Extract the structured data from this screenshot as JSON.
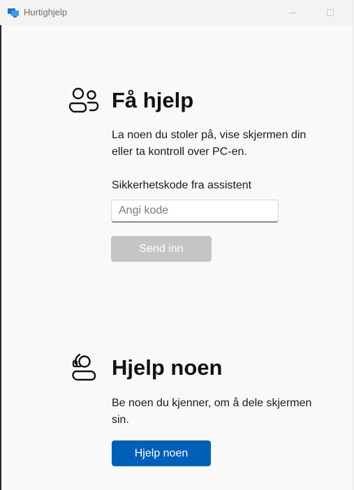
{
  "window": {
    "title": "Hurtighjelp",
    "icon": "remote-desktop-icon"
  },
  "get_help": {
    "icon": "people-icon",
    "heading": "Få hjelp",
    "description_line1": "La noen du stoler på, vise skjermen din",
    "description_line2": "eller ta kontroll over PC-en.",
    "code_label": "Sikkerhetskode fra assistent",
    "code_placeholder": "Angi kode",
    "code_value": "",
    "submit_label": "Send inn",
    "submit_enabled": false
  },
  "help_someone": {
    "icon": "person-headset-icon",
    "heading": "Hjelp noen",
    "description_line1": "Be noen du kjenner, om å dele skjermen",
    "description_line2": "sin.",
    "button_label": "Hjelp noen"
  },
  "colors": {
    "accent": "#005fb8",
    "disabled": "#c5c5c5",
    "background": "#f9f9f9"
  }
}
